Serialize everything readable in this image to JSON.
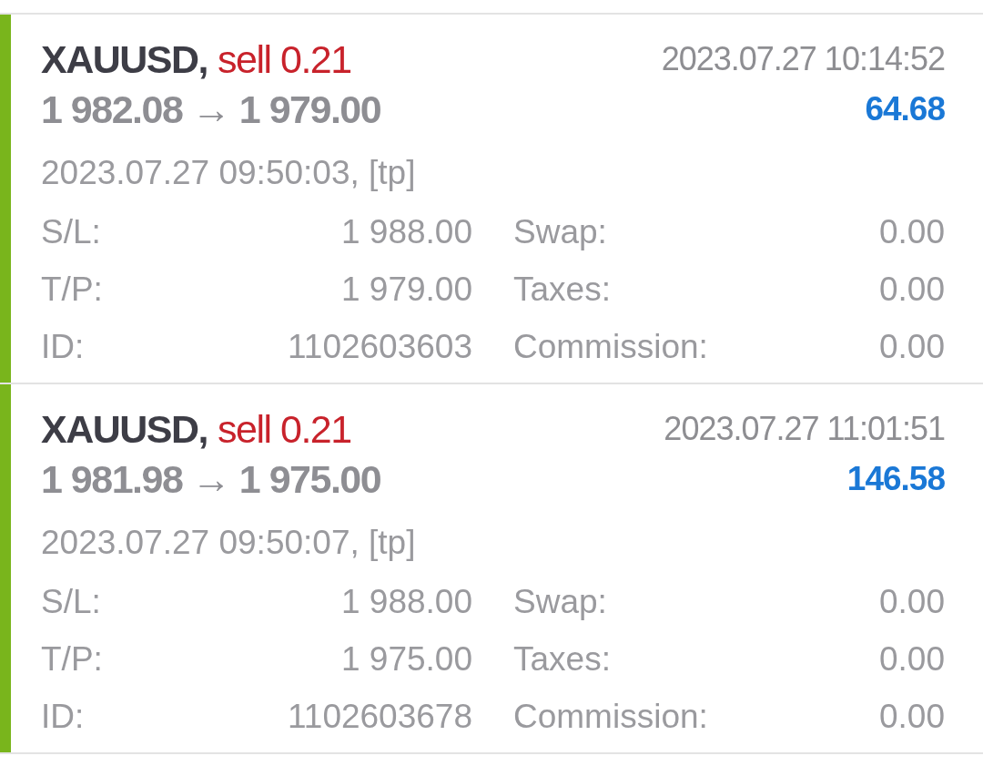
{
  "trades": [
    {
      "symbol": "XAUUSD,",
      "order": "sell 0.21",
      "close_time": "2023.07.27 10:14:52",
      "prices": "1 982.08 → 1 979.00",
      "profit": "64.68",
      "open_info": "2023.07.27 09:50:03, [tp]",
      "details": [
        {
          "label": "S/L:",
          "value": "1 988.00"
        },
        {
          "label": "Swap:",
          "value": "0.00"
        },
        {
          "label": "T/P:",
          "value": "1 979.00"
        },
        {
          "label": "Taxes:",
          "value": "0.00"
        },
        {
          "label": "ID:",
          "value": "1102603603"
        },
        {
          "label": "Commission:",
          "value": "0.00"
        }
      ]
    },
    {
      "symbol": "XAUUSD,",
      "order": "sell 0.21",
      "close_time": "2023.07.27 11:01:51",
      "prices": "1 981.98 → 1 975.00",
      "profit": "146.58",
      "open_info": "2023.07.27 09:50:07, [tp]",
      "details": [
        {
          "label": "S/L:",
          "value": "1 988.00"
        },
        {
          "label": "Swap:",
          "value": "0.00"
        },
        {
          "label": "T/P:",
          "value": "1 975.00"
        },
        {
          "label": "Taxes:",
          "value": "0.00"
        },
        {
          "label": "ID:",
          "value": "1102603678"
        },
        {
          "label": "Commission:",
          "value": "0.00"
        }
      ]
    }
  ]
}
